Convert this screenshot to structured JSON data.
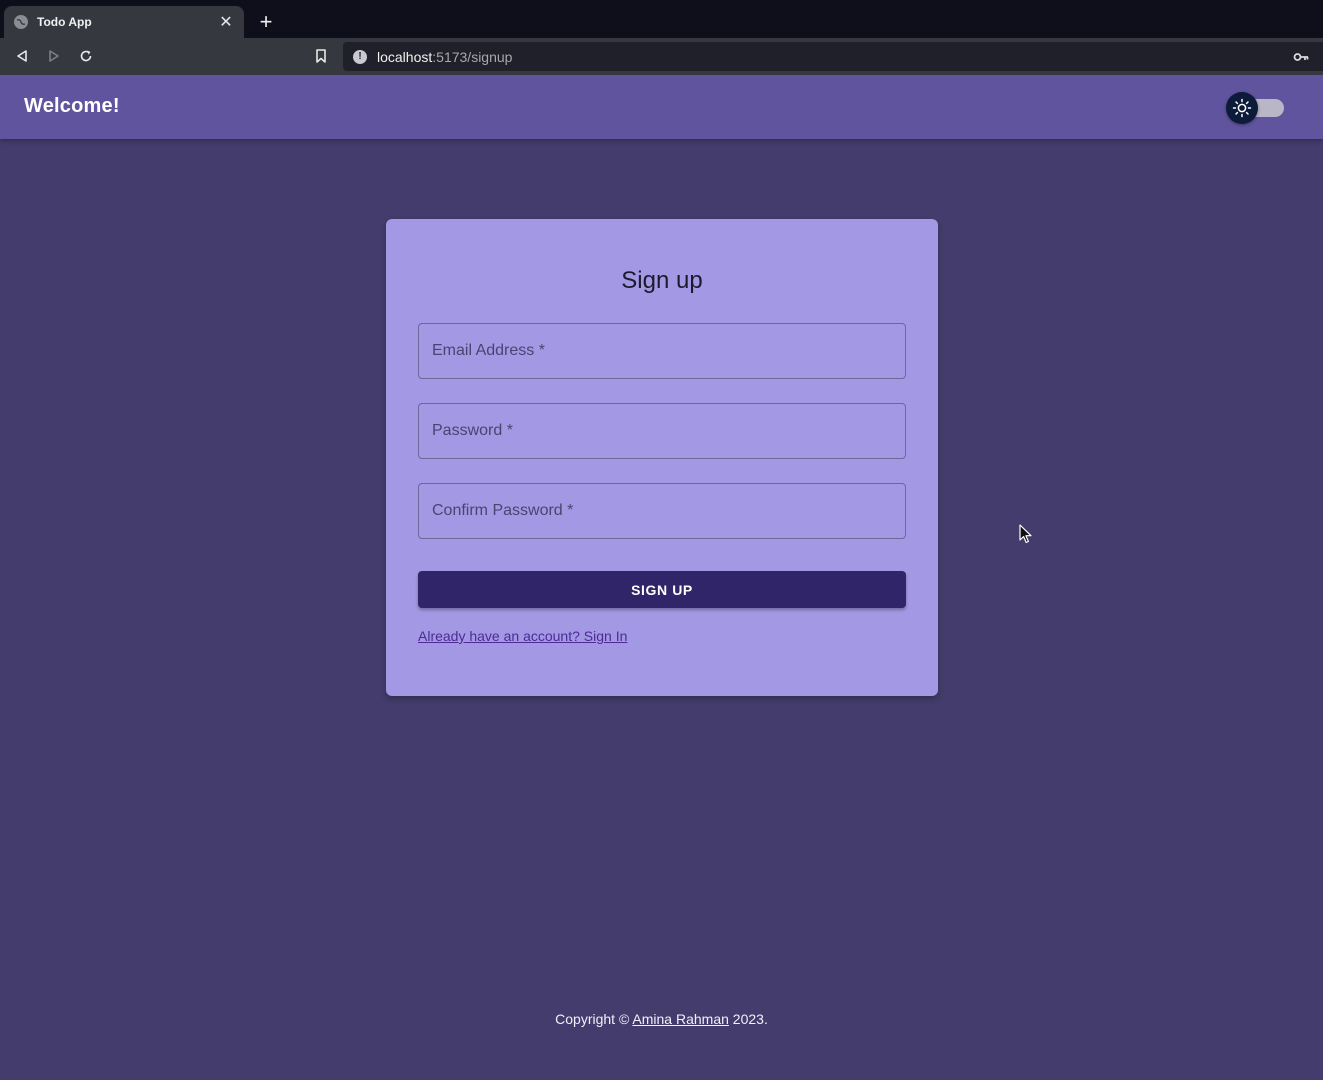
{
  "browser": {
    "tab_title": "Todo App",
    "close_glyph": "✕",
    "new_tab_glyph": "+",
    "address_host": "localhost",
    "address_path": ":5173/signup",
    "info_glyph": "!"
  },
  "appbar": {
    "title": "Welcome!",
    "theme_toggle_icon": "sun-icon",
    "color": "#61549f"
  },
  "form": {
    "title": "Sign up",
    "email_label": "Email Address *",
    "password_label": "Password *",
    "confirm_label": "Confirm Password *",
    "submit_label": "SIGN UP",
    "signin_link": "Already have an account? Sign In"
  },
  "footer": {
    "prefix": "Copyright © ",
    "author": "Amina Rahman",
    "suffix": " 2023."
  },
  "colors": {
    "background": "#433c6c",
    "card": "#a398e4",
    "button": "#2f2568"
  }
}
